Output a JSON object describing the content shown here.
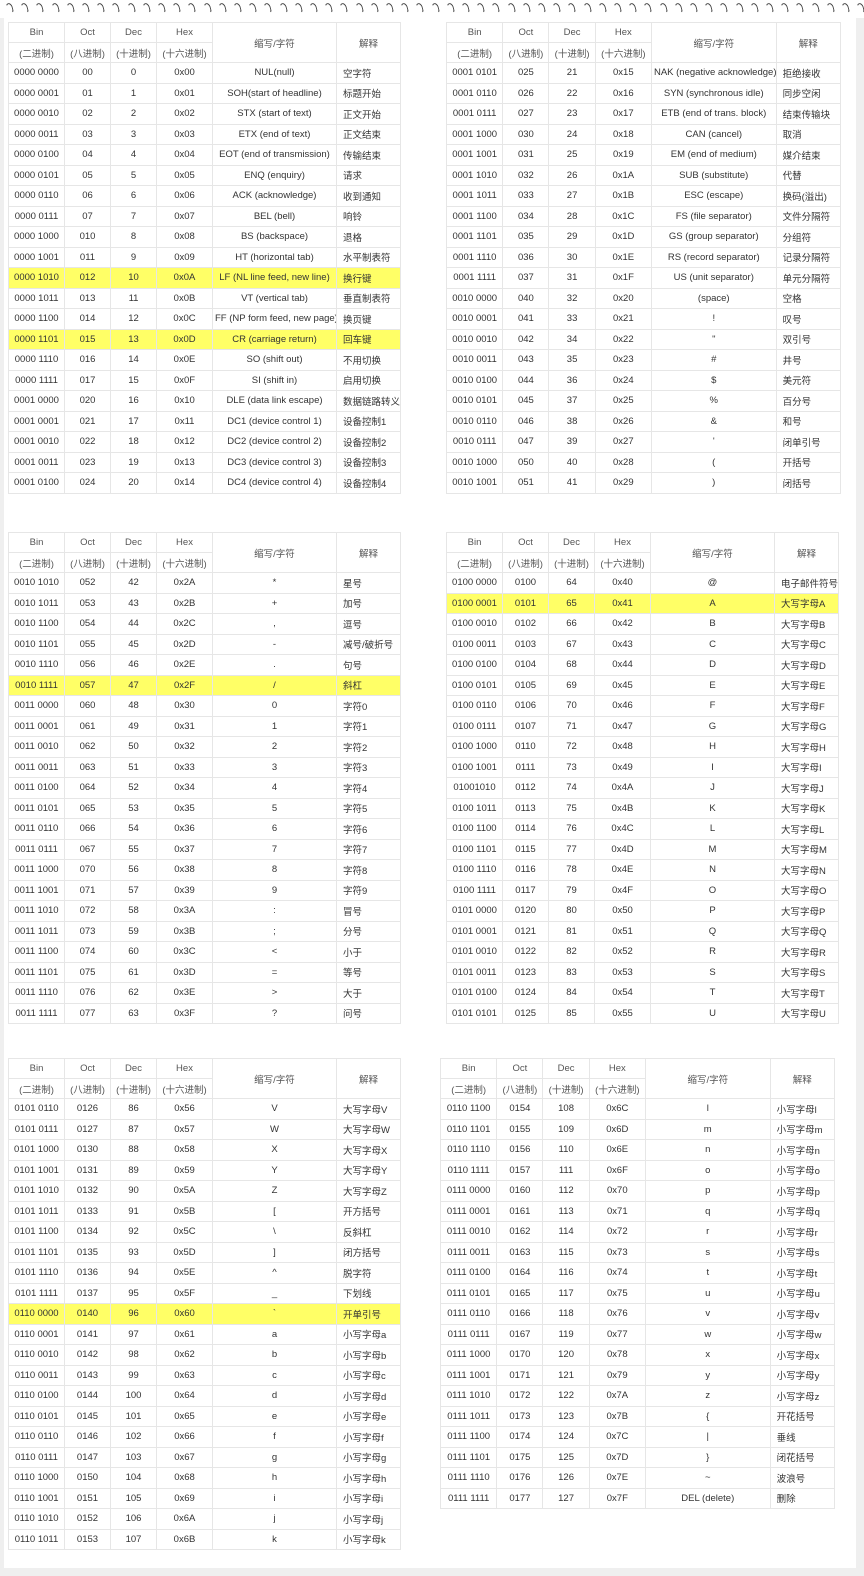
{
  "header_labels": {
    "bin": "Bin",
    "bin_sub": "(二进制)",
    "oct": "Oct",
    "oct_sub": "(八进制)",
    "dec": "Dec",
    "dec_sub": "(十进制)",
    "hex": "Hex",
    "hex_sub": "(十六进制)",
    "abbr": "缩写/字符",
    "exp": "解释"
  },
  "highlight_color": "#ffff66",
  "tables": [
    {
      "rows": [
        [
          "0000 0000",
          "00",
          "0",
          "0x00",
          "NUL(null)",
          "空字符"
        ],
        [
          "0000 0001",
          "01",
          "1",
          "0x01",
          "SOH(start of headline)",
          "标题开始"
        ],
        [
          "0000 0010",
          "02",
          "2",
          "0x02",
          "STX (start of text)",
          "正文开始"
        ],
        [
          "0000 0011",
          "03",
          "3",
          "0x03",
          "ETX (end of text)",
          "正文结束"
        ],
        [
          "0000 0100",
          "04",
          "4",
          "0x04",
          "EOT (end of transmission)",
          "传输结束"
        ],
        [
          "0000 0101",
          "05",
          "5",
          "0x05",
          "ENQ (enquiry)",
          "请求"
        ],
        [
          "0000 0110",
          "06",
          "6",
          "0x06",
          "ACK (acknowledge)",
          "收到通知"
        ],
        [
          "0000 0111",
          "07",
          "7",
          "0x07",
          "BEL (bell)",
          "响铃"
        ],
        [
          "0000 1000",
          "010",
          "8",
          "0x08",
          "BS (backspace)",
          "退格"
        ],
        [
          "0000 1001",
          "011",
          "9",
          "0x09",
          "HT (horizontal tab)",
          "水平制表符"
        ],
        [
          "0000 1010",
          "012",
          "10",
          "0x0A",
          "LF (NL line feed, new line)",
          "换行键"
        ],
        [
          "0000 1011",
          "013",
          "11",
          "0x0B",
          "VT (vertical tab)",
          "垂直制表符"
        ],
        [
          "0000 1100",
          "014",
          "12",
          "0x0C",
          "FF (NP form feed, new page)",
          "换页键"
        ],
        [
          "0000 1101",
          "015",
          "13",
          "0x0D",
          "CR (carriage return)",
          "回车键"
        ],
        [
          "0000 1110",
          "016",
          "14",
          "0x0E",
          "SO (shift out)",
          "不用切换"
        ],
        [
          "0000 1111",
          "017",
          "15",
          "0x0F",
          "SI (shift in)",
          "启用切换"
        ],
        [
          "0001 0000",
          "020",
          "16",
          "0x10",
          "DLE (data link escape)",
          "数据链路转义"
        ],
        [
          "0001 0001",
          "021",
          "17",
          "0x11",
          "DC1 (device control 1)",
          "设备控制1"
        ],
        [
          "0001 0010",
          "022",
          "18",
          "0x12",
          "DC2 (device control 2)",
          "设备控制2"
        ],
        [
          "0001 0011",
          "023",
          "19",
          "0x13",
          "DC3 (device control 3)",
          "设备控制3"
        ],
        [
          "0001 0100",
          "024",
          "20",
          "0x14",
          "DC4 (device control 4)",
          "设备控制4"
        ]
      ],
      "highlight": [
        10,
        13
      ]
    },
    {
      "rows": [
        [
          "0001 0101",
          "025",
          "21",
          "0x15",
          "NAK (negative acknowledge)",
          "拒绝接收"
        ],
        [
          "0001 0110",
          "026",
          "22",
          "0x16",
          "SYN (synchronous idle)",
          "同步空闲"
        ],
        [
          "0001 0111",
          "027",
          "23",
          "0x17",
          "ETB (end of trans. block)",
          "结束传输块"
        ],
        [
          "0001 1000",
          "030",
          "24",
          "0x18",
          "CAN (cancel)",
          "取消"
        ],
        [
          "0001 1001",
          "031",
          "25",
          "0x19",
          "EM (end of medium)",
          "媒介结束"
        ],
        [
          "0001 1010",
          "032",
          "26",
          "0x1A",
          "SUB (substitute)",
          "代替"
        ],
        [
          "0001 1011",
          "033",
          "27",
          "0x1B",
          "ESC (escape)",
          "换码(溢出)"
        ],
        [
          "0001 1100",
          "034",
          "28",
          "0x1C",
          "FS (file separator)",
          "文件分隔符"
        ],
        [
          "0001 1101",
          "035",
          "29",
          "0x1D",
          "GS (group separator)",
          "分组符"
        ],
        [
          "0001 1110",
          "036",
          "30",
          "0x1E",
          "RS (record separator)",
          "记录分隔符"
        ],
        [
          "0001 1111",
          "037",
          "31",
          "0x1F",
          "US (unit separator)",
          "单元分隔符"
        ],
        [
          "0010 0000",
          "040",
          "32",
          "0x20",
          "(space)",
          "空格"
        ],
        [
          "0010 0001",
          "041",
          "33",
          "0x21",
          "!",
          "叹号"
        ],
        [
          "0010 0010",
          "042",
          "34",
          "0x22",
          "\"",
          "双引号"
        ],
        [
          "0010 0011",
          "043",
          "35",
          "0x23",
          "#",
          "井号"
        ],
        [
          "0010 0100",
          "044",
          "36",
          "0x24",
          "$",
          "美元符"
        ],
        [
          "0010 0101",
          "045",
          "37",
          "0x25",
          "%",
          "百分号"
        ],
        [
          "0010 0110",
          "046",
          "38",
          "0x26",
          "&",
          "和号"
        ],
        [
          "0010 0111",
          "047",
          "39",
          "0x27",
          "'",
          "闭单引号"
        ],
        [
          "0010 1000",
          "050",
          "40",
          "0x28",
          "(",
          "开括号"
        ],
        [
          "0010 1001",
          "051",
          "41",
          "0x29",
          ")",
          "闭括号"
        ]
      ],
      "highlight": []
    },
    {
      "rows": [
        [
          "0010 1010",
          "052",
          "42",
          "0x2A",
          "*",
          "星号"
        ],
        [
          "0010 1011",
          "053",
          "43",
          "0x2B",
          "+",
          "加号"
        ],
        [
          "0010 1100",
          "054",
          "44",
          "0x2C",
          ",",
          "逗号"
        ],
        [
          "0010 1101",
          "055",
          "45",
          "0x2D",
          "-",
          "减号/破折号"
        ],
        [
          "0010 1110",
          "056",
          "46",
          "0x2E",
          ".",
          "句号"
        ],
        [
          "0010 1111",
          "057",
          "47",
          "0x2F",
          "/",
          "斜杠"
        ],
        [
          "0011 0000",
          "060",
          "48",
          "0x30",
          "0",
          "字符0"
        ],
        [
          "0011 0001",
          "061",
          "49",
          "0x31",
          "1",
          "字符1"
        ],
        [
          "0011 0010",
          "062",
          "50",
          "0x32",
          "2",
          "字符2"
        ],
        [
          "0011 0011",
          "063",
          "51",
          "0x33",
          "3",
          "字符3"
        ],
        [
          "0011 0100",
          "064",
          "52",
          "0x34",
          "4",
          "字符4"
        ],
        [
          "0011 0101",
          "065",
          "53",
          "0x35",
          "5",
          "字符5"
        ],
        [
          "0011 0110",
          "066",
          "54",
          "0x36",
          "6",
          "字符6"
        ],
        [
          "0011 0111",
          "067",
          "55",
          "0x37",
          "7",
          "字符7"
        ],
        [
          "0011 1000",
          "070",
          "56",
          "0x38",
          "8",
          "字符8"
        ],
        [
          "0011 1001",
          "071",
          "57",
          "0x39",
          "9",
          "字符9"
        ],
        [
          "0011 1010",
          "072",
          "58",
          "0x3A",
          ":",
          "冒号"
        ],
        [
          "0011 1011",
          "073",
          "59",
          "0x3B",
          ";",
          "分号"
        ],
        [
          "0011 1100",
          "074",
          "60",
          "0x3C",
          "<",
          "小于"
        ],
        [
          "0011 1101",
          "075",
          "61",
          "0x3D",
          "=",
          "等号"
        ],
        [
          "0011 1110",
          "076",
          "62",
          "0x3E",
          ">",
          "大于"
        ],
        [
          "0011 1111",
          "077",
          "63",
          "0x3F",
          "?",
          "问号"
        ]
      ],
      "highlight": [
        5
      ]
    },
    {
      "rows": [
        [
          "0100 0000",
          "0100",
          "64",
          "0x40",
          "@",
          "电子邮件符号"
        ],
        [
          "0100 0001",
          "0101",
          "65",
          "0x41",
          "A",
          "大写字母A"
        ],
        [
          "0100 0010",
          "0102",
          "66",
          "0x42",
          "B",
          "大写字母B"
        ],
        [
          "0100 0011",
          "0103",
          "67",
          "0x43",
          "C",
          "大写字母C"
        ],
        [
          "0100 0100",
          "0104",
          "68",
          "0x44",
          "D",
          "大写字母D"
        ],
        [
          "0100 0101",
          "0105",
          "69",
          "0x45",
          "E",
          "大写字母E"
        ],
        [
          "0100 0110",
          "0106",
          "70",
          "0x46",
          "F",
          "大写字母F"
        ],
        [
          "0100 0111",
          "0107",
          "71",
          "0x47",
          "G",
          "大写字母G"
        ],
        [
          "0100 1000",
          "0110",
          "72",
          "0x48",
          "H",
          "大写字母H"
        ],
        [
          "0100 1001",
          "0111",
          "73",
          "0x49",
          "I",
          "大写字母I"
        ],
        [
          "01001010",
          "0112",
          "74",
          "0x4A",
          "J",
          "大写字母J"
        ],
        [
          "0100 1011",
          "0113",
          "75",
          "0x4B",
          "K",
          "大写字母K"
        ],
        [
          "0100 1100",
          "0114",
          "76",
          "0x4C",
          "L",
          "大写字母L"
        ],
        [
          "0100 1101",
          "0115",
          "77",
          "0x4D",
          "M",
          "大写字母M"
        ],
        [
          "0100 1110",
          "0116",
          "78",
          "0x4E",
          "N",
          "大写字母N"
        ],
        [
          "0100 1111",
          "0117",
          "79",
          "0x4F",
          "O",
          "大写字母O"
        ],
        [
          "0101 0000",
          "0120",
          "80",
          "0x50",
          "P",
          "大写字母P"
        ],
        [
          "0101 0001",
          "0121",
          "81",
          "0x51",
          "Q",
          "大写字母Q"
        ],
        [
          "0101 0010",
          "0122",
          "82",
          "0x52",
          "R",
          "大写字母R"
        ],
        [
          "0101 0011",
          "0123",
          "83",
          "0x53",
          "S",
          "大写字母S"
        ],
        [
          "0101 0100",
          "0124",
          "84",
          "0x54",
          "T",
          "大写字母T"
        ],
        [
          "0101 0101",
          "0125",
          "85",
          "0x55",
          "U",
          "大写字母U"
        ]
      ],
      "highlight": [
        1
      ]
    },
    {
      "rows": [
        [
          "0101 0110",
          "0126",
          "86",
          "0x56",
          "V",
          "大写字母V"
        ],
        [
          "0101 0111",
          "0127",
          "87",
          "0x57",
          "W",
          "大写字母W"
        ],
        [
          "0101 1000",
          "0130",
          "88",
          "0x58",
          "X",
          "大写字母X"
        ],
        [
          "0101 1001",
          "0131",
          "89",
          "0x59",
          "Y",
          "大写字母Y"
        ],
        [
          "0101 1010",
          "0132",
          "90",
          "0x5A",
          "Z",
          "大写字母Z"
        ],
        [
          "0101 1011",
          "0133",
          "91",
          "0x5B",
          "[",
          "开方括号"
        ],
        [
          "0101 1100",
          "0134",
          "92",
          "0x5C",
          "\\",
          "反斜杠"
        ],
        [
          "0101 1101",
          "0135",
          "93",
          "0x5D",
          "]",
          "闭方括号"
        ],
        [
          "0101 1110",
          "0136",
          "94",
          "0x5E",
          "^",
          "脱字符"
        ],
        [
          "0101 1111",
          "0137",
          "95",
          "0x5F",
          "_",
          "下划线"
        ],
        [
          "0110 0000",
          "0140",
          "96",
          "0x60",
          "`",
          "开单引号"
        ],
        [
          "0110 0001",
          "0141",
          "97",
          "0x61",
          "a",
          "小写字母a"
        ],
        [
          "0110 0010",
          "0142",
          "98",
          "0x62",
          "b",
          "小写字母b"
        ],
        [
          "0110 0011",
          "0143",
          "99",
          "0x63",
          "c",
          "小写字母c"
        ],
        [
          "0110 0100",
          "0144",
          "100",
          "0x64",
          "d",
          "小写字母d"
        ],
        [
          "0110 0101",
          "0145",
          "101",
          "0x65",
          "e",
          "小写字母e"
        ],
        [
          "0110 0110",
          "0146",
          "102",
          "0x66",
          "f",
          "小写字母f"
        ],
        [
          "0110 0111",
          "0147",
          "103",
          "0x67",
          "g",
          "小写字母g"
        ],
        [
          "0110 1000",
          "0150",
          "104",
          "0x68",
          "h",
          "小写字母h"
        ],
        [
          "0110 1001",
          "0151",
          "105",
          "0x69",
          "i",
          "小写字母i"
        ],
        [
          "0110 1010",
          "0152",
          "106",
          "0x6A",
          "j",
          "小写字母j"
        ],
        [
          "0110 1011",
          "0153",
          "107",
          "0x6B",
          "k",
          "小写字母k"
        ]
      ],
      "highlight": [
        10
      ]
    },
    {
      "rows": [
        [
          "0110 1100",
          "0154",
          "108",
          "0x6C",
          "l",
          "小写字母l"
        ],
        [
          "0110 1101",
          "0155",
          "109",
          "0x6D",
          "m",
          "小写字母m"
        ],
        [
          "0110 1110",
          "0156",
          "110",
          "0x6E",
          "n",
          "小写字母n"
        ],
        [
          "0110 1111",
          "0157",
          "111",
          "0x6F",
          "o",
          "小写字母o"
        ],
        [
          "0111 0000",
          "0160",
          "112",
          "0x70",
          "p",
          "小写字母p"
        ],
        [
          "0111 0001",
          "0161",
          "113",
          "0x71",
          "q",
          "小写字母q"
        ],
        [
          "0111 0010",
          "0162",
          "114",
          "0x72",
          "r",
          "小写字母r"
        ],
        [
          "0111 0011",
          "0163",
          "115",
          "0x73",
          "s",
          "小写字母s"
        ],
        [
          "0111 0100",
          "0164",
          "116",
          "0x74",
          "t",
          "小写字母t"
        ],
        [
          "0111 0101",
          "0165",
          "117",
          "0x75",
          "u",
          "小写字母u"
        ],
        [
          "0111 0110",
          "0166",
          "118",
          "0x76",
          "v",
          "小写字母v"
        ],
        [
          "0111 0111",
          "0167",
          "119",
          "0x77",
          "w",
          "小写字母w"
        ],
        [
          "0111 1000",
          "0170",
          "120",
          "0x78",
          "x",
          "小写字母x"
        ],
        [
          "0111 1001",
          "0171",
          "121",
          "0x79",
          "y",
          "小写字母y"
        ],
        [
          "0111 1010",
          "0172",
          "122",
          "0x7A",
          "z",
          "小写字母z"
        ],
        [
          "0111 1011",
          "0173",
          "123",
          "0x7B",
          "{",
          "开花括号"
        ],
        [
          "0111 1100",
          "0174",
          "124",
          "0x7C",
          "|",
          "垂线"
        ],
        [
          "0111 1101",
          "0175",
          "125",
          "0x7D",
          "}",
          "闭花括号"
        ],
        [
          "0111 1110",
          "0176",
          "126",
          "0x7E",
          "~",
          "波浪号"
        ],
        [
          "0111 1111",
          "0177",
          "127",
          "0x7F",
          "DEL (delete)",
          "删除"
        ]
      ],
      "highlight": []
    }
  ]
}
